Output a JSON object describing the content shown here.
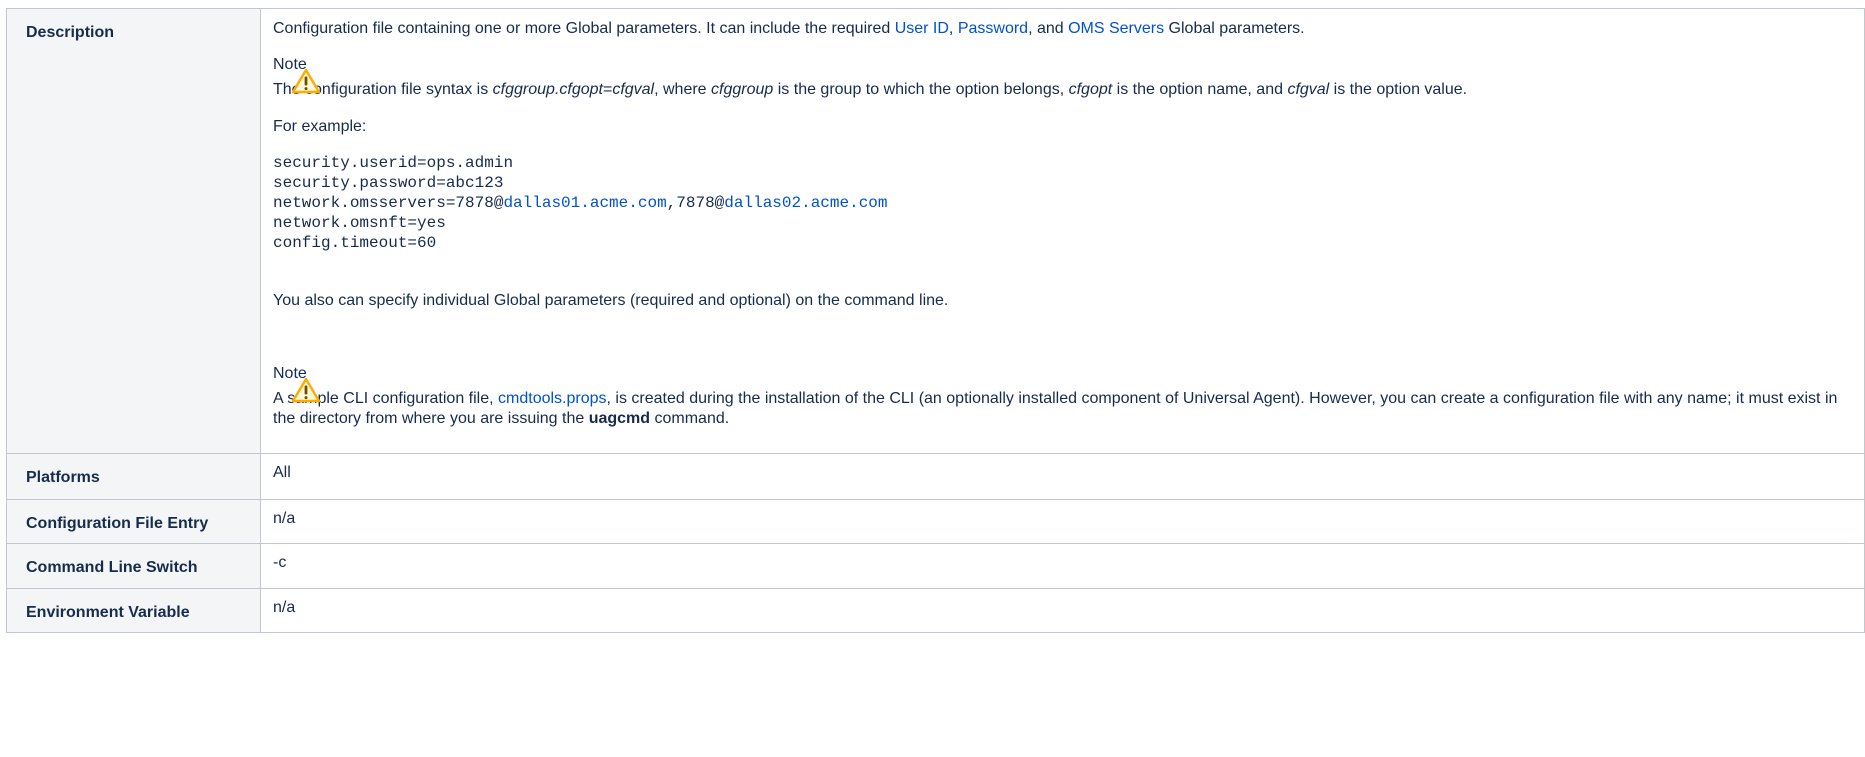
{
  "rows": [
    {
      "label": "Description"
    },
    {
      "label": "Platforms",
      "value": "All"
    },
    {
      "label": "Configuration File Entry",
      "value": "n/a"
    },
    {
      "label": "Command Line Switch",
      "value": "-c"
    },
    {
      "label": "Environment Variable",
      "value": "n/a"
    }
  ],
  "description": {
    "intro_pre": "Configuration file containing one or more Global parameters. It can include the required ",
    "link_user_id": "User ID",
    "sep1": ", ",
    "link_password": "Password",
    "sep2": ", and ",
    "link_oms_servers": "OMS Servers",
    "intro_post": " Global parameters.",
    "note1_title": "Note",
    "note1_a": "The configuration file syntax is ",
    "note1_i1": "cfggroup.cfgopt",
    "note1_b": "=",
    "note1_i2": "cfgval",
    "note1_c": ", where ",
    "note1_i3": "cfggroup",
    "note1_d": " is the group to which the option belongs, ",
    "note1_i4": "cfgopt",
    "note1_e": " is the option name, and ",
    "note1_i5": "cfgval",
    "note1_f": " is the option value.",
    "example_label": "For example:",
    "code_line1": "security.userid=ops.admin",
    "code_line2": "security.password=abc123",
    "code_line3_a": "network.omsservers=7878@",
    "code_line3_link1": "dallas01.acme.com",
    "code_line3_b": ",7878@",
    "code_line3_link2": "dallas02.acme.com",
    "code_line4": "network.omsnft=yes",
    "code_line5": "config.timeout=60",
    "also_text": "You also can specify individual Global parameters (required and optional) on the command line.",
    "note2_title": "Note",
    "note2_a": "A sample CLI configuration file, ",
    "note2_link": "cmdtools.props",
    "note2_b": ", is created during the installation of the CLI (an optionally installed component of Universal Agent). However, you can create a configuration file with any name; it must exist in the directory from where you are issuing the ",
    "note2_bold": "uagcmd",
    "note2_c": " command."
  },
  "colors": {
    "link": "#0052cc",
    "header_bg": "#f4f5f7",
    "border": "#c1c7d0",
    "warning": "#ffab00"
  },
  "icons": {
    "note": "warning-icon"
  }
}
